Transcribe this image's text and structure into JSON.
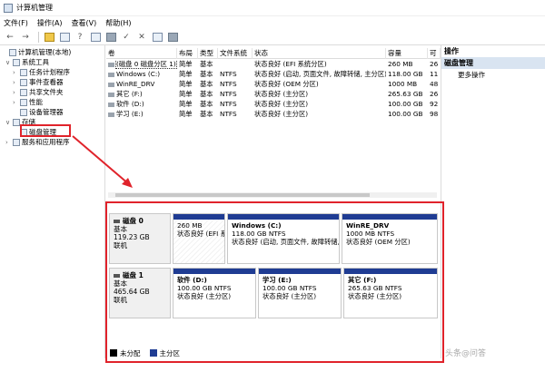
{
  "window": {
    "title": "计算机管理"
  },
  "menu": [
    "文件(F)",
    "操作(A)",
    "查看(V)",
    "帮助(H)"
  ],
  "tree": [
    {
      "label": "计算机管理(本地)",
      "caret": "",
      "indent": 0
    },
    {
      "label": "系统工具",
      "caret": "∨",
      "indent": 1
    },
    {
      "label": "任务计划程序",
      "caret": "›",
      "indent": 2
    },
    {
      "label": "事件查看器",
      "caret": "›",
      "indent": 2
    },
    {
      "label": "共享文件夹",
      "caret": "›",
      "indent": 2
    },
    {
      "label": "性能",
      "caret": "›",
      "indent": 2
    },
    {
      "label": "设备管理器",
      "caret": "",
      "indent": 2
    },
    {
      "label": "存储",
      "caret": "∨",
      "indent": 1
    },
    {
      "label": "磁盘管理",
      "caret": "",
      "indent": 2
    },
    {
      "label": "服务和应用程序",
      "caret": "›",
      "indent": 1
    }
  ],
  "grid": {
    "headers": [
      "卷",
      "布局",
      "类型",
      "文件系统",
      "状态",
      "容量",
      "可"
    ],
    "rows": [
      [
        "(磁盘 0 磁盘分区 1)",
        "简单",
        "基本",
        "",
        "状态良好 (EFI 系统分区)",
        "260 MB",
        "26"
      ],
      [
        "Windows (C:)",
        "简单",
        "基本",
        "NTFS",
        "状态良好 (启动, 页面文件, 故障转储, 主分区)",
        "118.00 GB",
        "11"
      ],
      [
        "WinRE_DRV",
        "简单",
        "基本",
        "NTFS",
        "状态良好 (OEM 分区)",
        "1000 MB",
        "48"
      ],
      [
        "其它 (F:)",
        "简单",
        "基本",
        "NTFS",
        "状态良好 (主分区)",
        "265.63 GB",
        "26"
      ],
      [
        "软件 (D:)",
        "简单",
        "基本",
        "NTFS",
        "状态良好 (主分区)",
        "100.00 GB",
        "92"
      ],
      [
        "学习 (E:)",
        "简单",
        "基本",
        "NTFS",
        "状态良好 (主分区)",
        "100.00 GB",
        "98"
      ]
    ]
  },
  "actions": {
    "title": "操作",
    "section": "磁盘管理",
    "items": [
      "更多操作"
    ]
  },
  "disks": [
    {
      "name": "磁盘 0",
      "type": "基本",
      "size": "119.23 GB",
      "status": "联机",
      "partitions": [
        {
          "name": "",
          "line1": "260 MB",
          "line2": "状态良好 (EFI 系"
        },
        {
          "name": "Windows (C:)",
          "line1": "118.00 GB NTFS",
          "line2": "状态良好 (启动, 页面文件, 故障转储,"
        },
        {
          "name": "WinRE_DRV",
          "line1": "1000 MB NTFS",
          "line2": "状态良好 (OEM 分区)"
        }
      ]
    },
    {
      "name": "磁盘 1",
      "type": "基本",
      "size": "465.64 GB",
      "status": "联机",
      "partitions": [
        {
          "name": "软件 (D:)",
          "line1": "100.00 GB NTFS",
          "line2": "状态良好 (主分区)"
        },
        {
          "name": "学习 (E:)",
          "line1": "100.00 GB NTFS",
          "line2": "状态良好 (主分区)"
        },
        {
          "name": "其它 (F:)",
          "line1": "265.63 GB NTFS",
          "line2": "状态良好 (主分区)"
        }
      ]
    }
  ],
  "legend": [
    {
      "label": "未分配",
      "color": "#000000"
    },
    {
      "label": "主分区",
      "color": "#1f3c93"
    }
  ],
  "watermark": "头条@问答",
  "colors": {
    "highlight": "#e0232b",
    "partition_bar": "#1f3c93",
    "selection": "#d9e4f1"
  }
}
